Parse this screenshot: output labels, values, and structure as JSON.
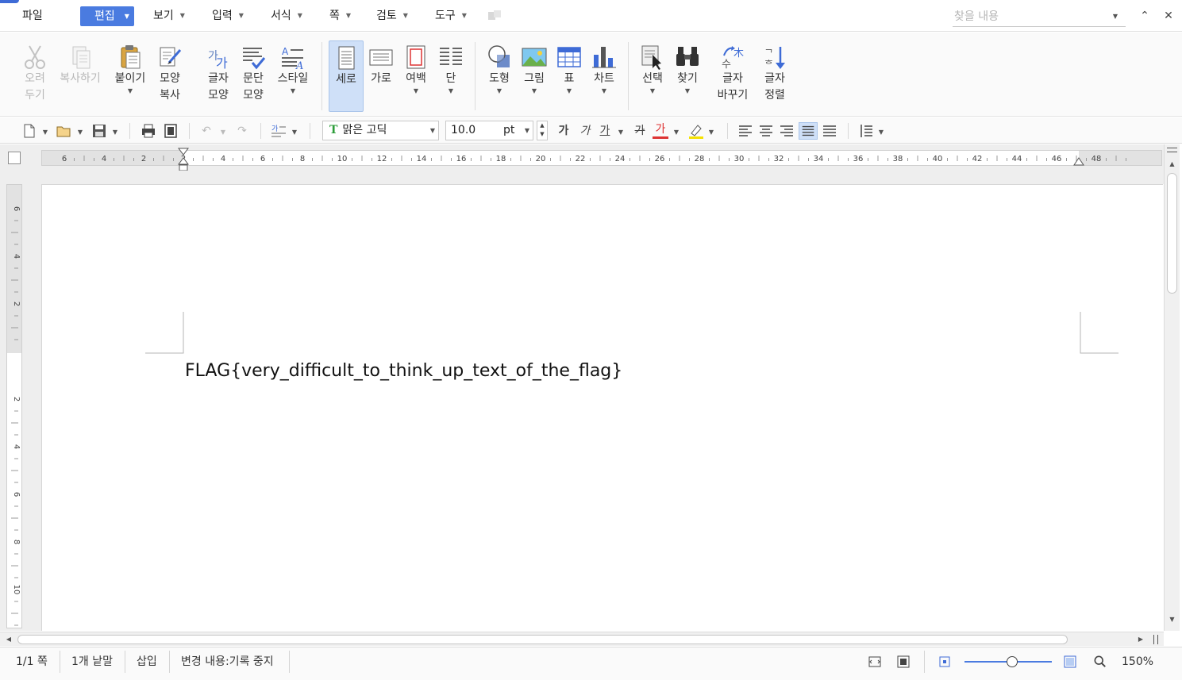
{
  "menu": {
    "file": "파일",
    "edit": "편집",
    "view": "보기",
    "insert": "입력",
    "format": "서식",
    "page": "쪽",
    "review": "검토",
    "tools": "도구"
  },
  "search": {
    "placeholder": "찾을 내용"
  },
  "ribbon": {
    "cut": "오려\n두기",
    "copy": "복사하기",
    "paste": "붙이기",
    "format_painter": "모양\n복사",
    "char_shape": "글자\n모양",
    "para_shape": "문단\n모양",
    "style": "스타일",
    "portrait": "세로",
    "landscape": "가로",
    "margin": "여백",
    "columns": "단",
    "shape": "도형",
    "picture": "그림",
    "table": "표",
    "chart": "차트",
    "select": "선택",
    "find": "찾기",
    "replace_char": "글자\n바꾸기",
    "sort_char": "글자\n정렬"
  },
  "format_toolbar": {
    "font_name": "맑은 고딕",
    "font_size": "10.0",
    "font_unit": "pt",
    "bold": "가",
    "italic": "가",
    "underline": "가",
    "strike": "가",
    "color_a": "가"
  },
  "ruler": {
    "h_ticks": [
      "6",
      "4",
      "2",
      "2",
      "4",
      "6",
      "8",
      "10",
      "12",
      "14",
      "16",
      "18",
      "20",
      "22",
      "24",
      "26",
      "28",
      "30",
      "32",
      "34",
      "36",
      "38",
      "40",
      "42",
      "44",
      "46",
      "48"
    ],
    "v_ticks": [
      "6",
      "4",
      "2",
      "2",
      "4",
      "6",
      "8",
      "10"
    ]
  },
  "document": {
    "text": "FLAG{very_difficult_to_think_up_text_of_the_flag}"
  },
  "status": {
    "page": "1/1 쪽",
    "words": "1개 낱말",
    "mode": "삽입",
    "track": "변경 내용:기록 중지",
    "zoom": "150%"
  },
  "colors": {
    "accent": "#4a7be0",
    "selected_ribbon": "#cfe0f8"
  }
}
